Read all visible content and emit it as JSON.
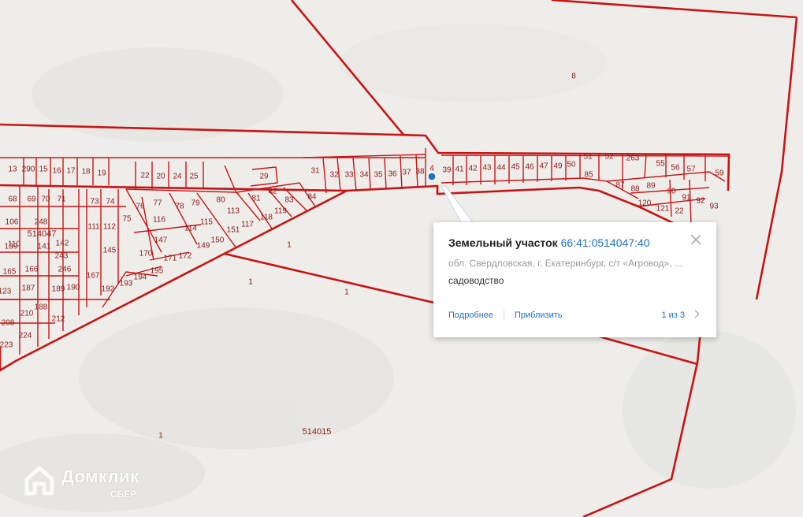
{
  "map": {
    "colors": {
      "boundary": "#c81414",
      "label": "#8a1a1a",
      "background": "#eeedea",
      "marker": "#1f6fc4"
    },
    "plot_labels": [
      "13",
      "290",
      "15",
      "16",
      "17",
      "18",
      "19",
      "22",
      "20",
      "24",
      "25",
      "29",
      "31",
      "32",
      "33",
      "34",
      "35",
      "36",
      "37",
      "38",
      "4",
      "39",
      "41",
      "42",
      "43",
      "44",
      "45",
      "46",
      "47",
      "49",
      "50",
      "51",
      "52",
      "263",
      "55",
      "56",
      "57",
      "59",
      "85",
      "87",
      "88",
      "89",
      "90",
      "91",
      "92",
      "93",
      "120",
      "121",
      "22",
      "69",
      "70",
      "71",
      "68",
      "106",
      "248",
      "73",
      "74",
      "76",
      "77",
      "78",
      "79",
      "80",
      "82",
      "81",
      "83",
      "84",
      "113",
      "115",
      "118",
      "117",
      "119",
      "116",
      "114",
      "111",
      "112",
      "110",
      "141",
      "142",
      "139",
      "243",
      "145",
      "147",
      "149",
      "150",
      "151",
      "170",
      "171",
      "172",
      "165",
      "166",
      "246",
      "167",
      "75",
      "187",
      "189",
      "190",
      "192",
      "193",
      "194",
      "195",
      "188",
      "208",
      "210",
      "212",
      "223",
      "224",
      "123"
    ],
    "block_labels": [
      "514047",
      "514015"
    ],
    "zone_labels": [
      "8",
      "1",
      "1",
      "1",
      "1"
    ]
  },
  "popup": {
    "title": "Земельный участок",
    "cadastral_number": "66:41:0514047:40",
    "address": "обл. Свердловская, г. Екатеринбург, с/т «Агровод», ...",
    "land_use": "садоводство",
    "link_details": "Подробнее",
    "link_zoom": "Приблизить",
    "page_counter": "1 из 3"
  },
  "logo": {
    "name": "Домклик",
    "sub": "СБЕР"
  }
}
